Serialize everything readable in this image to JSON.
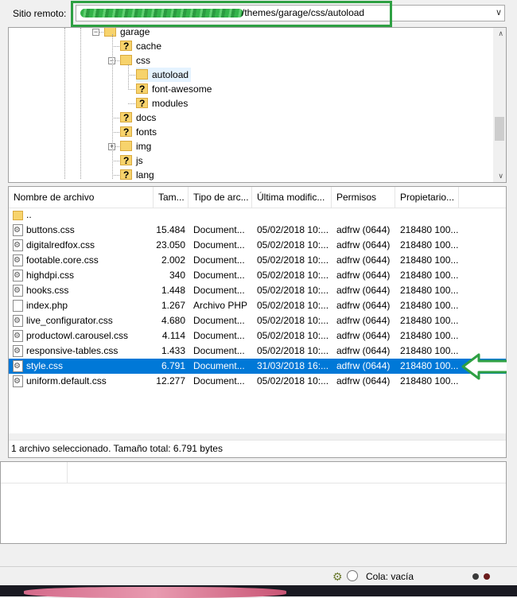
{
  "remote": {
    "label": "Sitio remoto:",
    "path": "/themes/garage/css/autoload",
    "dropdown_icon": "chevron-down-icon"
  },
  "tree": [
    {
      "name": "garage",
      "icon": "folder",
      "expander": "−"
    },
    {
      "name": "cache",
      "icon": "folder-unknown"
    },
    {
      "name": "css",
      "icon": "folder",
      "expander": "−"
    },
    {
      "name": "autoload",
      "icon": "folder",
      "selected": true
    },
    {
      "name": "font-awesome",
      "icon": "folder-unknown"
    },
    {
      "name": "modules",
      "icon": "folder-unknown"
    },
    {
      "name": "docs",
      "icon": "folder-unknown"
    },
    {
      "name": "fonts",
      "icon": "folder-unknown"
    },
    {
      "name": "img",
      "icon": "folder",
      "expander": "+"
    },
    {
      "name": "js",
      "icon": "folder-unknown"
    },
    {
      "name": "lang",
      "icon": "folder-unknown"
    }
  ],
  "columns": [
    "Nombre de archivo",
    "Tam...",
    "Tipo de arc...",
    "Última modific...",
    "Permisos",
    "Propietario..."
  ],
  "files": [
    {
      "name": "..",
      "size": "",
      "type": "",
      "modified": "",
      "perms": "",
      "owner": "",
      "icon": "folder"
    },
    {
      "name": "buttons.css",
      "size": "15.484",
      "type": "Document...",
      "modified": "05/02/2018 10:...",
      "perms": "adfrw (0644)",
      "owner": "218480 100...",
      "icon": "css"
    },
    {
      "name": "digitalredfox.css",
      "size": "23.050",
      "type": "Document...",
      "modified": "05/02/2018 10:...",
      "perms": "adfrw (0644)",
      "owner": "218480 100...",
      "icon": "css"
    },
    {
      "name": "footable.core.css",
      "size": "2.002",
      "type": "Document...",
      "modified": "05/02/2018 10:...",
      "perms": "adfrw (0644)",
      "owner": "218480 100...",
      "icon": "css"
    },
    {
      "name": "highdpi.css",
      "size": "340",
      "type": "Document...",
      "modified": "05/02/2018 10:...",
      "perms": "adfrw (0644)",
      "owner": "218480 100...",
      "icon": "css"
    },
    {
      "name": "hooks.css",
      "size": "1.448",
      "type": "Document...",
      "modified": "05/02/2018 10:...",
      "perms": "adfrw (0644)",
      "owner": "218480 100...",
      "icon": "css"
    },
    {
      "name": "index.php",
      "size": "1.267",
      "type": "Archivo PHP",
      "modified": "05/02/2018 10:...",
      "perms": "adfrw (0644)",
      "owner": "218480 100...",
      "icon": "php"
    },
    {
      "name": "live_configurator.css",
      "size": "4.680",
      "type": "Document...",
      "modified": "05/02/2018 10:...",
      "perms": "adfrw (0644)",
      "owner": "218480 100...",
      "icon": "css"
    },
    {
      "name": "productowl.carousel.css",
      "size": "4.114",
      "type": "Document...",
      "modified": "05/02/2018 10:...",
      "perms": "adfrw (0644)",
      "owner": "218480 100...",
      "icon": "css"
    },
    {
      "name": "responsive-tables.css",
      "size": "1.433",
      "type": "Document...",
      "modified": "05/02/2018 10:...",
      "perms": "adfrw (0644)",
      "owner": "218480 100...",
      "icon": "css"
    },
    {
      "name": "style.css",
      "size": "6.791",
      "type": "Document...",
      "modified": "31/03/2018 16:...",
      "perms": "adfrw (0644)",
      "owner": "218480 100...",
      "icon": "css",
      "selected": true
    },
    {
      "name": "uniform.default.css",
      "size": "12.277",
      "type": "Document...",
      "modified": "05/02/2018 10:...",
      "perms": "adfrw (0644)",
      "owner": "218480 100...",
      "icon": "css"
    }
  ],
  "file_status": "1 archivo seleccionado. Tamaño total: 6.791 bytes",
  "status_bar": {
    "queue": "Cola: vacía"
  },
  "colors": {
    "selection": "#0078d7",
    "highlight_box": "#2ea043",
    "arrow": "#2ea043"
  }
}
